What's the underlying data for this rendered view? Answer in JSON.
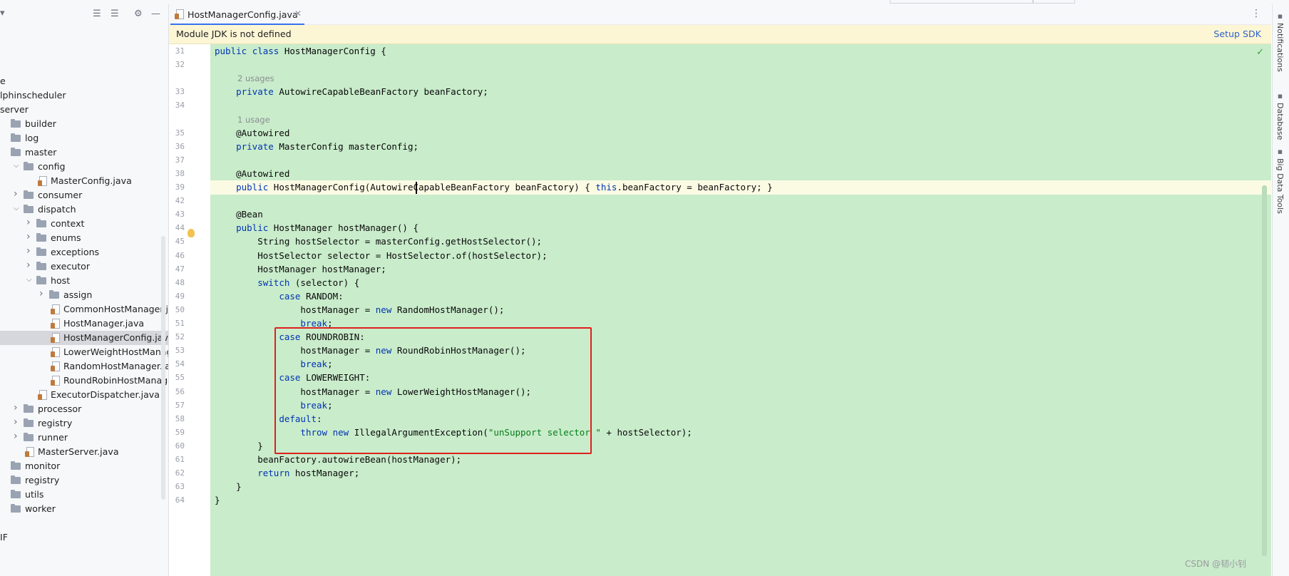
{
  "editor": {
    "tab_label": "HostManagerConfig.java",
    "banner_message": "Module JDK is not defined",
    "banner_action": "Setup SDK",
    "lines": [
      {
        "n": "31",
        "parts": [
          [
            "kw",
            "public "
          ],
          [
            "kw",
            "class "
          ],
          [
            "t",
            "HostManagerConfig {"
          ]
        ]
      },
      {
        "n": "32",
        "parts": []
      },
      {
        "hint": "2 usages"
      },
      {
        "n": "33",
        "parts": [
          [
            "t",
            "    "
          ],
          [
            "kw",
            "private "
          ],
          [
            "t",
            "AutowireCapableBeanFactory beanFactory;"
          ]
        ]
      },
      {
        "n": "34",
        "parts": []
      },
      {
        "hint": "1 usage"
      },
      {
        "n": "35",
        "parts": [
          [
            "t",
            "    @Autowired"
          ]
        ]
      },
      {
        "n": "36",
        "parts": [
          [
            "t",
            "    "
          ],
          [
            "kw",
            "private "
          ],
          [
            "t",
            "MasterConfig masterConfig;"
          ]
        ]
      },
      {
        "n": "37",
        "parts": []
      },
      {
        "n": "38",
        "parts": [
          [
            "t",
            "    @Autowired"
          ]
        ]
      },
      {
        "n": "39",
        "current": true,
        "parts": [
          [
            "t",
            "    "
          ],
          [
            "kw",
            "public "
          ],
          [
            "t",
            "HostManagerConfig(AutowireCapableBeanFactory beanFactory) { "
          ],
          [
            "kw",
            "this"
          ],
          [
            "t",
            ".beanFactory = beanFactory; }"
          ]
        ]
      },
      {
        "n": "42",
        "parts": []
      },
      {
        "n": "43",
        "parts": [
          [
            "t",
            "    @Bean"
          ]
        ]
      },
      {
        "n": "44",
        "parts": [
          [
            "t",
            "    "
          ],
          [
            "kw",
            "public "
          ],
          [
            "t",
            "HostManager hostManager() {"
          ]
        ]
      },
      {
        "n": "45",
        "parts": [
          [
            "t",
            "        String hostSelector = masterConfig.getHostSelector();"
          ]
        ]
      },
      {
        "n": "46",
        "parts": [
          [
            "t",
            "        HostSelector selector = HostSelector.of(hostSelector);"
          ]
        ]
      },
      {
        "n": "47",
        "parts": [
          [
            "t",
            "        HostManager hostManager;"
          ]
        ]
      },
      {
        "n": "48",
        "parts": [
          [
            "t",
            "        "
          ],
          [
            "kw",
            "switch "
          ],
          [
            "t",
            "(selector) {"
          ]
        ]
      },
      {
        "n": "49",
        "parts": [
          [
            "t",
            "            "
          ],
          [
            "kw",
            "case "
          ],
          [
            "t",
            "RANDOM:"
          ]
        ]
      },
      {
        "n": "50",
        "parts": [
          [
            "t",
            "                hostManager = "
          ],
          [
            "kw",
            "new "
          ],
          [
            "t",
            "RandomHostManager();"
          ]
        ]
      },
      {
        "n": "51",
        "parts": [
          [
            "t",
            "                "
          ],
          [
            "kw",
            "break"
          ],
          [
            "t",
            ";"
          ]
        ]
      },
      {
        "n": "52",
        "parts": [
          [
            "t",
            "            "
          ],
          [
            "kw",
            "case "
          ],
          [
            "t",
            "ROUNDROBIN:"
          ]
        ]
      },
      {
        "n": "53",
        "parts": [
          [
            "t",
            "                hostManager = "
          ],
          [
            "kw",
            "new "
          ],
          [
            "t",
            "RoundRobinHostManager();"
          ]
        ]
      },
      {
        "n": "54",
        "parts": [
          [
            "t",
            "                "
          ],
          [
            "kw",
            "break"
          ],
          [
            "t",
            ";"
          ]
        ]
      },
      {
        "n": "55",
        "parts": [
          [
            "t",
            "            "
          ],
          [
            "kw",
            "case "
          ],
          [
            "t",
            "LOWERWEIGHT:"
          ]
        ]
      },
      {
        "n": "56",
        "parts": [
          [
            "t",
            "                hostManager = "
          ],
          [
            "kw",
            "new "
          ],
          [
            "t",
            "LowerWeightHostManager();"
          ]
        ]
      },
      {
        "n": "57",
        "parts": [
          [
            "t",
            "                "
          ],
          [
            "kw",
            "break"
          ],
          [
            "t",
            ";"
          ]
        ]
      },
      {
        "n": "58",
        "parts": [
          [
            "t",
            "            "
          ],
          [
            "kw",
            "default"
          ],
          [
            "t",
            ":"
          ]
        ]
      },
      {
        "n": "59",
        "parts": [
          [
            "t",
            "                "
          ],
          [
            "kw",
            "throw "
          ],
          [
            "kw",
            "new "
          ],
          [
            "t",
            "IllegalArgumentException("
          ],
          [
            "st",
            "\"unSupport selector \""
          ],
          [
            "t",
            " + hostSelector);"
          ]
        ]
      },
      {
        "n": "60",
        "parts": [
          [
            "t",
            "        }"
          ]
        ]
      },
      {
        "n": "61",
        "parts": [
          [
            "t",
            "        beanFactory.autowireBean(hostManager);"
          ]
        ]
      },
      {
        "n": "62",
        "parts": [
          [
            "t",
            "        "
          ],
          [
            "kw",
            "return "
          ],
          [
            "t",
            "hostManager;"
          ]
        ]
      },
      {
        "n": "63",
        "parts": [
          [
            "t",
            "    }"
          ]
        ]
      },
      {
        "n": "64",
        "parts": [
          [
            "t",
            "}"
          ]
        ]
      }
    ]
  },
  "project_tree": [
    {
      "label": "e",
      "indent": 0,
      "kind": "text"
    },
    {
      "label": "lphinscheduler",
      "indent": 0,
      "kind": "text"
    },
    {
      "label": "server",
      "indent": 0,
      "kind": "text"
    },
    {
      "label": "builder",
      "indent": 1,
      "kind": "folder"
    },
    {
      "label": "log",
      "indent": 1,
      "kind": "folder"
    },
    {
      "label": "master",
      "indent": 1,
      "kind": "folder"
    },
    {
      "label": "config",
      "indent": 2,
      "kind": "folder",
      "arrow": "open"
    },
    {
      "label": "MasterConfig.java",
      "indent": 3,
      "kind": "java"
    },
    {
      "label": "consumer",
      "indent": 2,
      "kind": "folder",
      "arrow": "closed"
    },
    {
      "label": "dispatch",
      "indent": 2,
      "kind": "folder",
      "arrow": "open"
    },
    {
      "label": "context",
      "indent": 3,
      "kind": "folder",
      "arrow": "closed"
    },
    {
      "label": "enums",
      "indent": 3,
      "kind": "folder",
      "arrow": "closed"
    },
    {
      "label": "exceptions",
      "indent": 3,
      "kind": "folder",
      "arrow": "closed"
    },
    {
      "label": "executor",
      "indent": 3,
      "kind": "folder",
      "arrow": "closed"
    },
    {
      "label": "host",
      "indent": 3,
      "kind": "folder",
      "arrow": "open"
    },
    {
      "label": "assign",
      "indent": 4,
      "kind": "folder",
      "arrow": "closed"
    },
    {
      "label": "CommonHostManager.java",
      "indent": 4,
      "kind": "java"
    },
    {
      "label": "HostManager.java",
      "indent": 4,
      "kind": "java"
    },
    {
      "label": "HostManagerConfig.java",
      "indent": 4,
      "kind": "java",
      "selected": true
    },
    {
      "label": "LowerWeightHostManager.j",
      "indent": 4,
      "kind": "java"
    },
    {
      "label": "RandomHostManager.java",
      "indent": 4,
      "kind": "java"
    },
    {
      "label": "RoundRobinHostManager.ja",
      "indent": 4,
      "kind": "java"
    },
    {
      "label": "ExecutorDispatcher.java",
      "indent": 3,
      "kind": "java"
    },
    {
      "label": "processor",
      "indent": 2,
      "kind": "folder",
      "arrow": "closed"
    },
    {
      "label": "registry",
      "indent": 2,
      "kind": "folder",
      "arrow": "closed"
    },
    {
      "label": "runner",
      "indent": 2,
      "kind": "folder",
      "arrow": "closed"
    },
    {
      "label": "MasterServer.java",
      "indent": 2,
      "kind": "java"
    },
    {
      "label": "monitor",
      "indent": 1,
      "kind": "folder"
    },
    {
      "label": "registry",
      "indent": 1,
      "kind": "folder"
    },
    {
      "label": "utils",
      "indent": 1,
      "kind": "folder"
    },
    {
      "label": "worker",
      "indent": 1,
      "kind": "folder"
    },
    {
      "label": "",
      "indent": 0,
      "kind": "text"
    },
    {
      "label": "IF",
      "indent": 0,
      "kind": "text"
    }
  ],
  "right_toolbar": [
    {
      "label": "Notifications",
      "icon": "bell-icon"
    },
    {
      "label": "Database",
      "icon": "database-icon"
    },
    {
      "label": "Big Data Tools",
      "icon": "bigdata-icon"
    }
  ],
  "watermark": "CSDN @韧小钊",
  "icons": {
    "tab_more": "⋮",
    "inspection_ok": "✓"
  },
  "colors": {
    "background_highlight": "#c9eccb",
    "annotation_box": "#e0201d",
    "keyword": "#0033b3",
    "string": "#067d17"
  }
}
